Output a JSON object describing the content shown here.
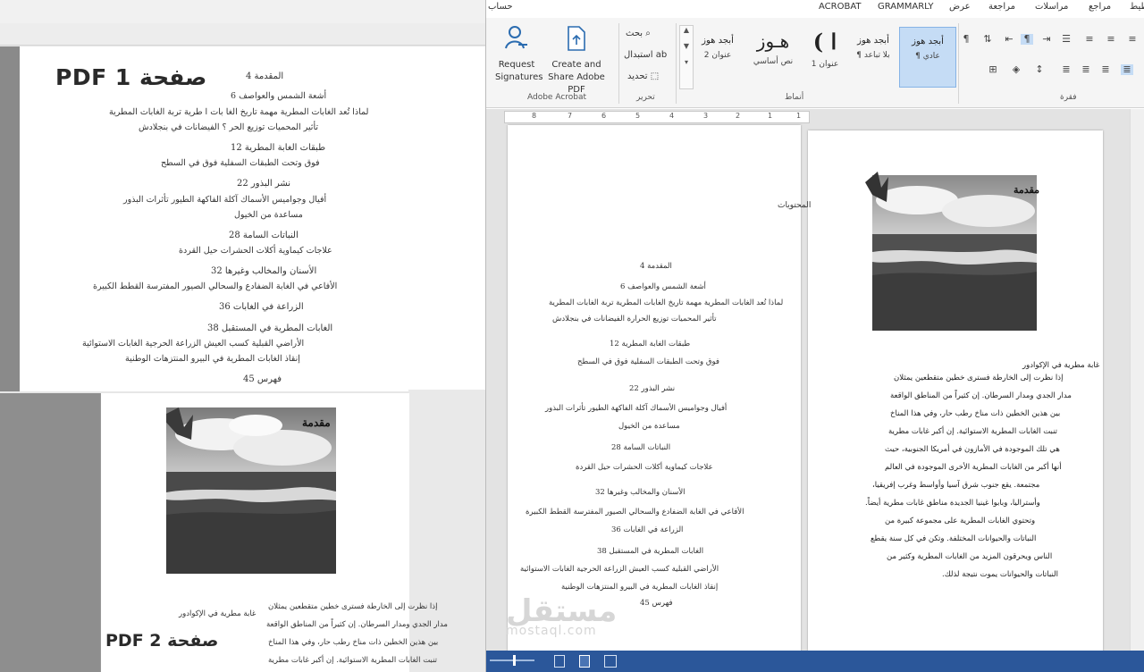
{
  "pdf1": {
    "label": "PDF 1 صفحة",
    "toc": {
      "l1": "المقدمة   4",
      "l2": "أشعة الشمس والعواصف   6",
      "l3": "لماذا تُعد الغابات المطرية مهمة   تاريخ الغا بات ا طرية    تربة الغابات المطرية",
      "l4": "تأثير المحميات     توزيع الحر ؟    الفيضانات في بنجلادش",
      "l5": "طبقات الغابة المطرية   12",
      "l6": "فوق وتحت      الطبقات السفلية      فوق في السطح",
      "l7": "نشر البذور   22",
      "l8": "أفيال وجواميس          الأسماك آكلة الفاكهة  الطيور     تأثرات البذور",
      "l9": "مساعدة من الخيول",
      "l10": "النباتات السامة   28",
      "l11": "علاجات كيماوية     أكلات الحشرات      حيل القردة",
      "l12": "الأسنان والمخالب وغيرها   32",
      "l13": "الأفاعي في الغابة          الضفادع والسحالي       الصيور المفترسة       القطط الكبيرة",
      "l14": "الزراعة في الغابات   36",
      "l15": "الغابات المطرية في المستقبل   38",
      "l16": "الأراضي القبلية         كسب العيش         الزراعة الحرجية          الغابات الاستوائية",
      "l17": "إنقاذ الغابات المطرية         في البيرو          المنتزهات الوطنية",
      "l18": "فهرس   45"
    }
  },
  "pdf2": {
    "label": "PDF 2 صفحة",
    "photo_title": "مقدمة",
    "caption": "غابة مطرية في الإكوادور",
    "lines": [
      "إذا نظرت إلى الخارطة فسترى خطين متقطعين يمثلان",
      "مدار الجدي ومدار السرطان. إن كثيراً من المناطق الواقعة",
      "بين هذين الخطين ذات مناخ رطب حار، وفي هذا المناخ",
      "تنبت الغابات المطرية الاستوائية. إن أكبر غابات مطرية"
    ]
  },
  "word": {
    "tabs": [
      "حساب",
      "ACROBAT",
      "GRAMMARLY",
      "عرض",
      "مراجعة",
      "مراسلات",
      "مراجع",
      "تخطيط"
    ],
    "ribbon": {
      "request_signatures": "Request Signatures",
      "create_share": "Create and Share Adobe PDF",
      "acrobat_group": "Adobe Acrobat",
      "find": "بحث",
      "replace": "استبدال",
      "select": "تحديد",
      "edit_group": "تحرير",
      "styles": [
        {
          "sample": "أبجد هوز",
          "name": "¶ عادي"
        },
        {
          "sample": "أبجد هوز",
          "name": "¶ بلا تباعد"
        },
        {
          "sample": "( ا",
          "name": "عنوان 1"
        },
        {
          "sample": "هـوز",
          "name": "نص أساسي"
        },
        {
          "sample": "أبجد هوز",
          "name": "عنوان 2"
        }
      ],
      "styles_group": "أنماط",
      "paragraph_group": "فقرة"
    },
    "ruler_numbers": [
      "8",
      "7",
      "6",
      "5",
      "4",
      "3",
      "2",
      "1",
      "1"
    ],
    "left_page": {
      "side_title": "المحتويات",
      "toc": [
        "المقدمة 4",
        "أشعة الشمس والعواصف 6",
        "لماذا تُعد الغابات المطرية مهمة   تاريخ الغابات المطرية   تربة الغابات المطرية",
        "تأثير المحميات    توزيع الحرارة    الفيضانات في بنجلادش",
        "طبقات الغابة المطرية 12",
        "فوق وتحت الطبقات السفلية فوق في السطح",
        "نشر البذور 22",
        "أفيال وجواميس       الأسماك آكلة الفاكهة الطيور    تأثرات البذور",
        "مساعدة من الخيول",
        "النباتات السامة 28",
        "علاجات كيماوية    أكلات الحشرات    حيل القردة",
        "الأسنان والمخالب وغيرها 32",
        "الأفاعي في الغابة       الضفادع والسحالي       الصيور المفترسة القطط الكبيرة",
        "الزراعة في الغابات 36",
        "الغابات المطرية في المستقبل 38",
        "الأراضي القبلية   كسب العيش      الزراعة الحرجية       الغابات الاستوائية",
        "إنقاذ الغابات المطرية      في البيرو المنتزهات الوطنية",
        "فهرس 45"
      ]
    },
    "right_page": {
      "photo_title": "مقدمة",
      "caption": "غابة مطرية في الإكوادور",
      "lines": [
        "إذا نظرت إلى الخارطة فسترى خطين متقطعين يمثلان",
        "مدار الجدي ومدار السرطان. إن كثيراً من المناطق الواقعة",
        "بين هذين الخطين ذات مناخ رطب حار، وفي هذا المناخ",
        "تنبت الغابات المطرية الاستوائية. إن أكبر غابات مطرية",
        "هي تلك الموجودة في الأمازون في أمريكا الجنوبية، حيث",
        "أنها أكبر من الغابات المطرية الأخرى الموجودة في العالم",
        "مجتمعة. يقع جنوب شرق آسيا وأواسط وغرب إفريقيا،",
        "وأستراليا، وبابوا غينيا الجديدة مناطق غابات مطرية أيضاً.",
        "وتحتوي الغابات المطرية على مجموعة كبيرة من",
        "النباتات والحيوانات المختلفة. وتكن في كل سنة يقطع",
        "الناس ويحرقون المزيد من الغابات المطرية وكثير من",
        "النباتات والحيوانات يموت نتيجة لذلك."
      ]
    }
  },
  "watermark": {
    "arabic": "مستقل",
    "latin": "mostaql.com"
  },
  "colors": {
    "statusbar": "#2b579a",
    "style_selected": "#c5dcf5"
  }
}
